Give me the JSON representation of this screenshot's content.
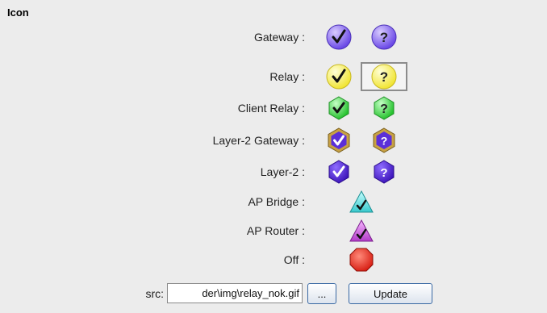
{
  "section_title": "Icon",
  "rows": [
    {
      "label": "Gateway :",
      "ok_icon": "gateway-ok-icon",
      "nok_icon": "gateway-nok-icon"
    },
    {
      "label": "Relay :",
      "ok_icon": "relay-ok-icon",
      "nok_icon": "relay-nok-icon",
      "selected": "nok"
    },
    {
      "label": "Client Relay :",
      "ok_icon": "client-relay-ok-icon",
      "nok_icon": "client-relay-nok-icon"
    },
    {
      "label": "Layer-2 Gateway :",
      "ok_icon": "layer2-gateway-ok-icon",
      "nok_icon": "layer2-gateway-nok-icon"
    },
    {
      "label": "Layer-2 :",
      "ok_icon": "layer2-ok-icon",
      "nok_icon": "layer2-nok-icon"
    },
    {
      "label": "AP Bridge :",
      "icon": "ap-bridge-icon"
    },
    {
      "label": "AP Router :",
      "icon": "ap-router-icon"
    },
    {
      "label": "Off :",
      "icon": "off-icon"
    }
  ],
  "colors": {
    "gateway": "#8a6cf0",
    "relay": "#fbf35a",
    "client_relay": "#3fd94a",
    "layer2_gateway_fill": "#5b2fd8",
    "layer2_gateway_border": "#c8a244",
    "layer2": "#4a1fcf",
    "ap_bridge": "#5fe0e0",
    "ap_router": "#d85de6",
    "off": "#e8281c"
  },
  "src": {
    "label": "src:",
    "value": "der\\img\\relay_nok.gif",
    "browse_label": "...",
    "update_label": "Update"
  }
}
